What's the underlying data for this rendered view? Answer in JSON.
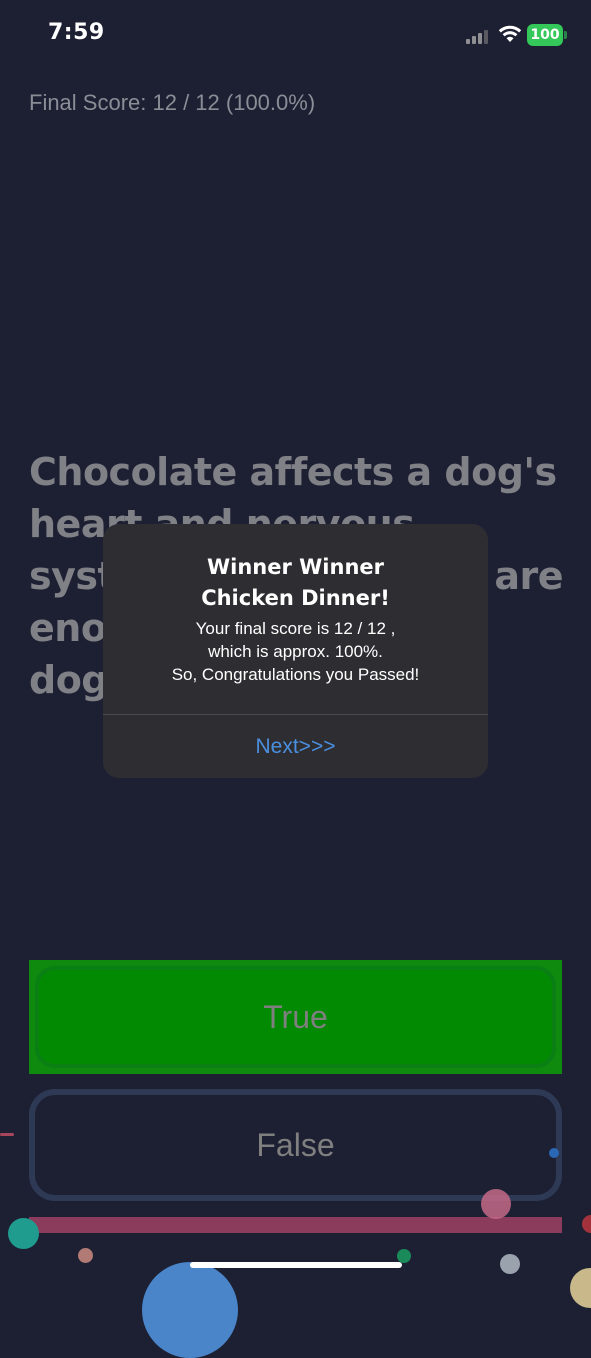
{
  "status_bar": {
    "time": "7:59",
    "battery": "100"
  },
  "quiz": {
    "score_text": "Final Score: 12 / 12 (100.0%)",
    "question": "Chocolate affects a dog's heart and nervous system; a few ounces are enough to kill a small dog.",
    "answers": {
      "true_label": "True",
      "false_label": "False"
    },
    "progress": 1.0
  },
  "alert": {
    "title_line1": "Winner Winner",
    "title_line2": "Chicken Dinner!",
    "message_line1": "Your final score is 12 / 12 ,",
    "message_line2": "which is approx. 100%.",
    "message_line3": "So, Congratulations you Passed!",
    "button_label": "Next>>>"
  },
  "colors": {
    "background": "#1d2033",
    "correct": "#028b02",
    "accent": "#4a8fe0",
    "progress": "#8b3b5b"
  }
}
